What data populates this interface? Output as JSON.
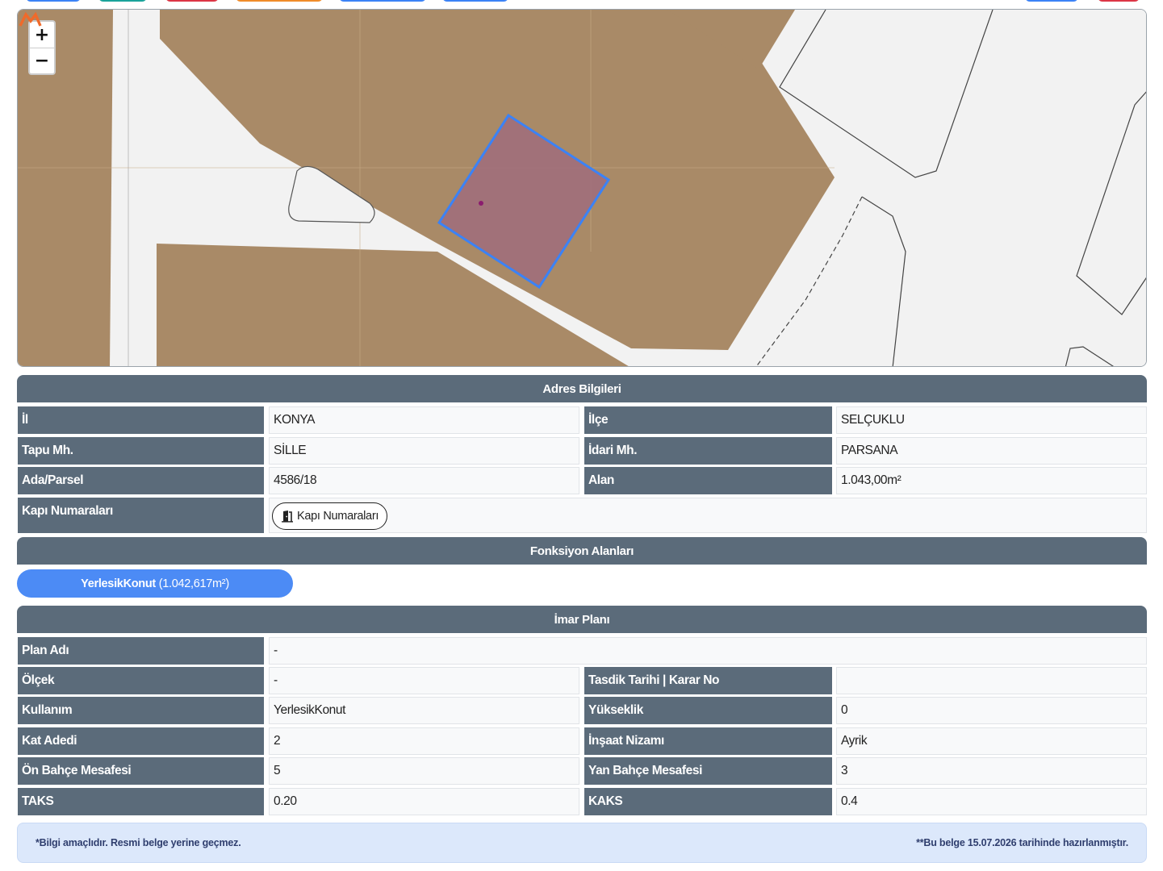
{
  "map": {
    "zoom_in": "+",
    "zoom_out": "−"
  },
  "address": {
    "header": "Adres Bilgileri",
    "il_label": "İl",
    "il_value": "KONYA",
    "ilce_label": "İlçe",
    "ilce_value": "SELÇUKLU",
    "tapu_label": "Tapu Mh.",
    "tapu_value": "SİLLE",
    "idari_label": "İdari Mh.",
    "idari_value": "PARSANA",
    "ada_label": "Ada/Parsel",
    "ada_value": "4586/18",
    "alan_label": "Alan",
    "alan_value": "1.043,00m²",
    "kapi_label": "Kapı Numaraları",
    "kapi_button": "Kapı Numaraları"
  },
  "fonksiyon": {
    "header": "Fonksiyon Alanları",
    "item_name": "YerlesikKonut",
    "item_area": "(1.042,617m²)"
  },
  "imar": {
    "header": "İmar Planı",
    "plan_label": "Plan Adı",
    "plan_value": "-",
    "olcek_label": "Ölçek",
    "olcek_value": "-",
    "tasdik_label": "Tasdik Tarihi | Karar No",
    "tasdik_value": "",
    "kullanim_label": "Kullanım",
    "kullanim_value": "YerlesikKonut",
    "yukseklik_label": "Yükseklik",
    "yukseklik_value": "0",
    "kat_label": "Kat Adedi",
    "kat_value": "2",
    "insaat_label": "İnşaat Nizamı",
    "insaat_value": "Ayrik",
    "onbahce_label": "Ön Bahçe Mesafesi",
    "onbahce_value": "5",
    "yanbahce_label": "Yan Bahçe Mesafesi",
    "yanbahce_value": "3",
    "taks_label": "TAKS",
    "taks_value": "0.20",
    "kaks_label": "KAKS",
    "kaks_value": "0.4"
  },
  "footer": {
    "left": "*Bilgi amaçlıdır. Resmi belge yerine geçmez.",
    "right": "**Bu belge 15.07.2026 tarihinde hazırlanmıştır."
  },
  "colors": {
    "header_bg": "#5b6b7a",
    "parcel_fill": "#a0707a",
    "parcel_stroke": "#3b82f6",
    "zone_fill": "#a98a67",
    "pill_bg": "#4c8bf5",
    "footer_bg": "#dce8fb"
  }
}
